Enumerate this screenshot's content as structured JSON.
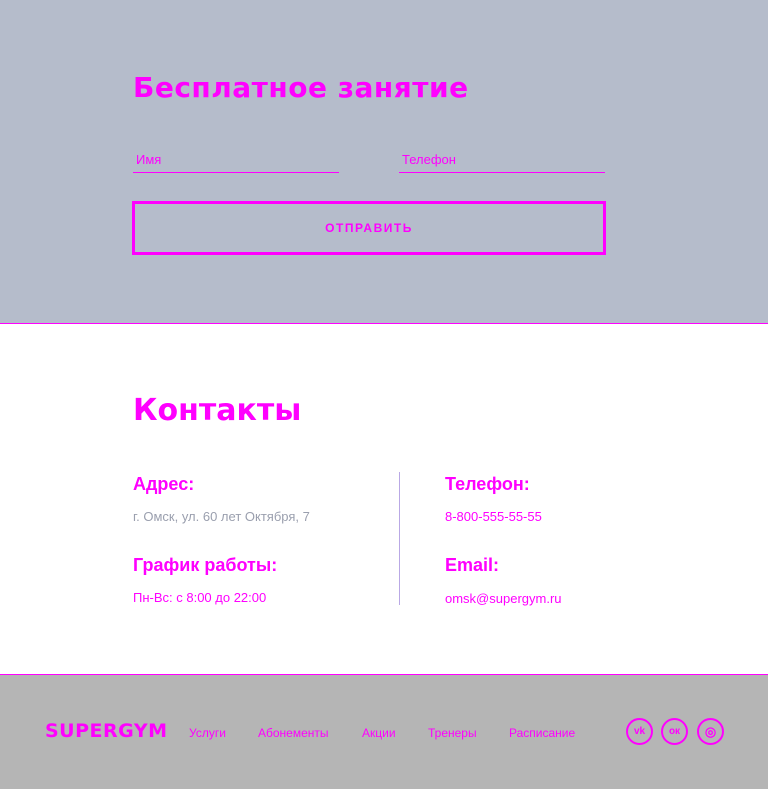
{
  "form": {
    "title": "Бесплатное занятие",
    "name_placeholder": "Имя",
    "phone_placeholder": "Телефон",
    "submit_label": "ОТПРАВИТЬ"
  },
  "contacts": {
    "title": "Контакты",
    "address_label": "Адрес:",
    "address_value": "г. Омск, ул. 60 лет Октября, 7",
    "schedule_label": "График работы:",
    "schedule_value": "Пн-Вс: с 8:00 до 22:00",
    "phone_label": "Телефон:",
    "phone_value": "8-800-555-55-55",
    "email_label": "Email:",
    "email_value": "omsk@supergym.ru"
  },
  "footer": {
    "logo": "SUPERGYM",
    "nav": [
      "Услуги",
      "Абонементы",
      "Акции",
      "Тренеры",
      "Расписание"
    ],
    "social": [
      {
        "icon": "vk-icon",
        "glyph": "vk"
      },
      {
        "icon": "odnoklassniki-icon",
        "glyph": "ок"
      },
      {
        "icon": "instagram-icon",
        "glyph": "◎"
      }
    ]
  },
  "colors": {
    "accent": "#ff00ff",
    "form_bg": "#b5bccb",
    "footer_bg": "#b5b5b5",
    "muted_text": "#9a9fae"
  }
}
